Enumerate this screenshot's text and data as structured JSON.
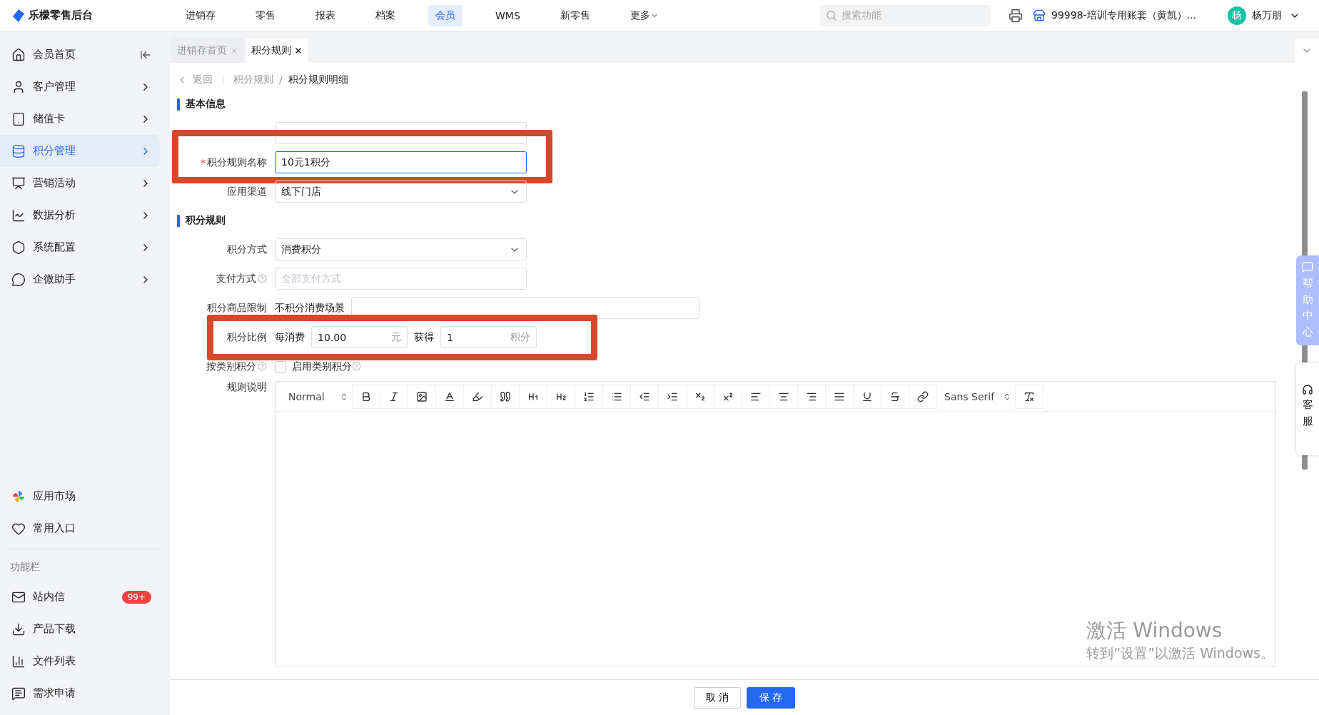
{
  "app": {
    "logo": "乐檬零售后台"
  },
  "nav": [
    {
      "label": "进销存",
      "selected": false,
      "dropdown": false
    },
    {
      "label": "零售",
      "selected": false,
      "dropdown": false
    },
    {
      "label": "报表",
      "selected": false,
      "dropdown": false
    },
    {
      "label": "档案",
      "selected": false,
      "dropdown": false
    },
    {
      "label": "会员",
      "selected": true,
      "dropdown": false
    },
    {
      "label": "WMS",
      "selected": false,
      "dropdown": false
    },
    {
      "label": "新零售",
      "selected": false,
      "dropdown": false
    },
    {
      "label": "更多",
      "selected": false,
      "dropdown": true
    }
  ],
  "search": {
    "placeholder": "搜索功能"
  },
  "account": {
    "store": "99998-培训专用账套（黄凯）...",
    "avatar": "杨",
    "user": "杨万朋"
  },
  "tabs": [
    {
      "label": "进销存首页",
      "selected": false
    },
    {
      "label": "积分规则",
      "selected": true
    }
  ],
  "sidebar": {
    "items": [
      {
        "label": "会员首页",
        "selected": false,
        "collapse": true
      },
      {
        "label": "客户管理",
        "selected": false,
        "collapse": false
      },
      {
        "label": "储值卡",
        "selected": false,
        "collapse": false
      },
      {
        "label": "积分管理",
        "selected": true,
        "collapse": false
      },
      {
        "label": "营销活动",
        "selected": false,
        "collapse": false
      },
      {
        "label": "数据分析",
        "selected": false,
        "collapse": false
      },
      {
        "label": "系统配置",
        "selected": false,
        "collapse": false
      },
      {
        "label": "企微助手",
        "selected": false,
        "collapse": false
      }
    ],
    "bottom": [
      {
        "label": "应用市场"
      },
      {
        "label": "常用入口"
      }
    ],
    "section": "功能栏",
    "tools": [
      {
        "label": "站内信",
        "badge": "99+"
      },
      {
        "label": "产品下载"
      },
      {
        "label": "文件列表"
      },
      {
        "label": "需求申请"
      }
    ]
  },
  "breadcrumb": {
    "back": "返回",
    "separator": "/",
    "items": [
      "积分规则",
      "积分规则明细"
    ]
  },
  "sections": [
    {
      "title": "基本信息",
      "rows": [
        {
          "kind": "input",
          "focused": false,
          "highlight": false
        },
        {
          "kind": "input",
          "label": "积分规则名称",
          "required_mark": "*",
          "value": "10元1积分",
          "focused": true,
          "highlight": true
        },
        {
          "kind": "select",
          "label": "应用渠道",
          "value": "线下门店",
          "highlight": false
        }
      ]
    },
    {
      "title": "积分规则",
      "rows": [
        {
          "kind": "select",
          "label": "积分方式",
          "value": "消费积分",
          "highlight": false
        },
        {
          "kind": "input",
          "label": "支付方式",
          "placeholder": "全部支付方式",
          "help": true,
          "focused": false,
          "highlight": false
        },
        {
          "kind": "limit",
          "label": "积分商品限制",
          "text": "不积分消费场景",
          "highlight": false
        },
        {
          "kind": "ratio",
          "label": "积分比例",
          "prefix": "每消费",
          "amount": "10.00",
          "unit": "元",
          "middle": "获得",
          "points": "1",
          "points_unit": "积分",
          "highlight": true
        },
        {
          "kind": "checkbox",
          "label": "按类别积分",
          "option": "启用类别积分",
          "checked": false,
          "help": true,
          "highlight": false
        },
        {
          "kind": "editor",
          "label": "规则说明",
          "format": "Normal",
          "font": "Sans Serif"
        }
      ]
    }
  ],
  "footer": {
    "cancel": "取 消",
    "save": "保 存"
  },
  "float": {
    "help": "帮助中心",
    "service": "客服"
  },
  "os_overlay": {
    "line1": "激活 Windows",
    "line2": "转到“设置”以激活 Windows。"
  }
}
